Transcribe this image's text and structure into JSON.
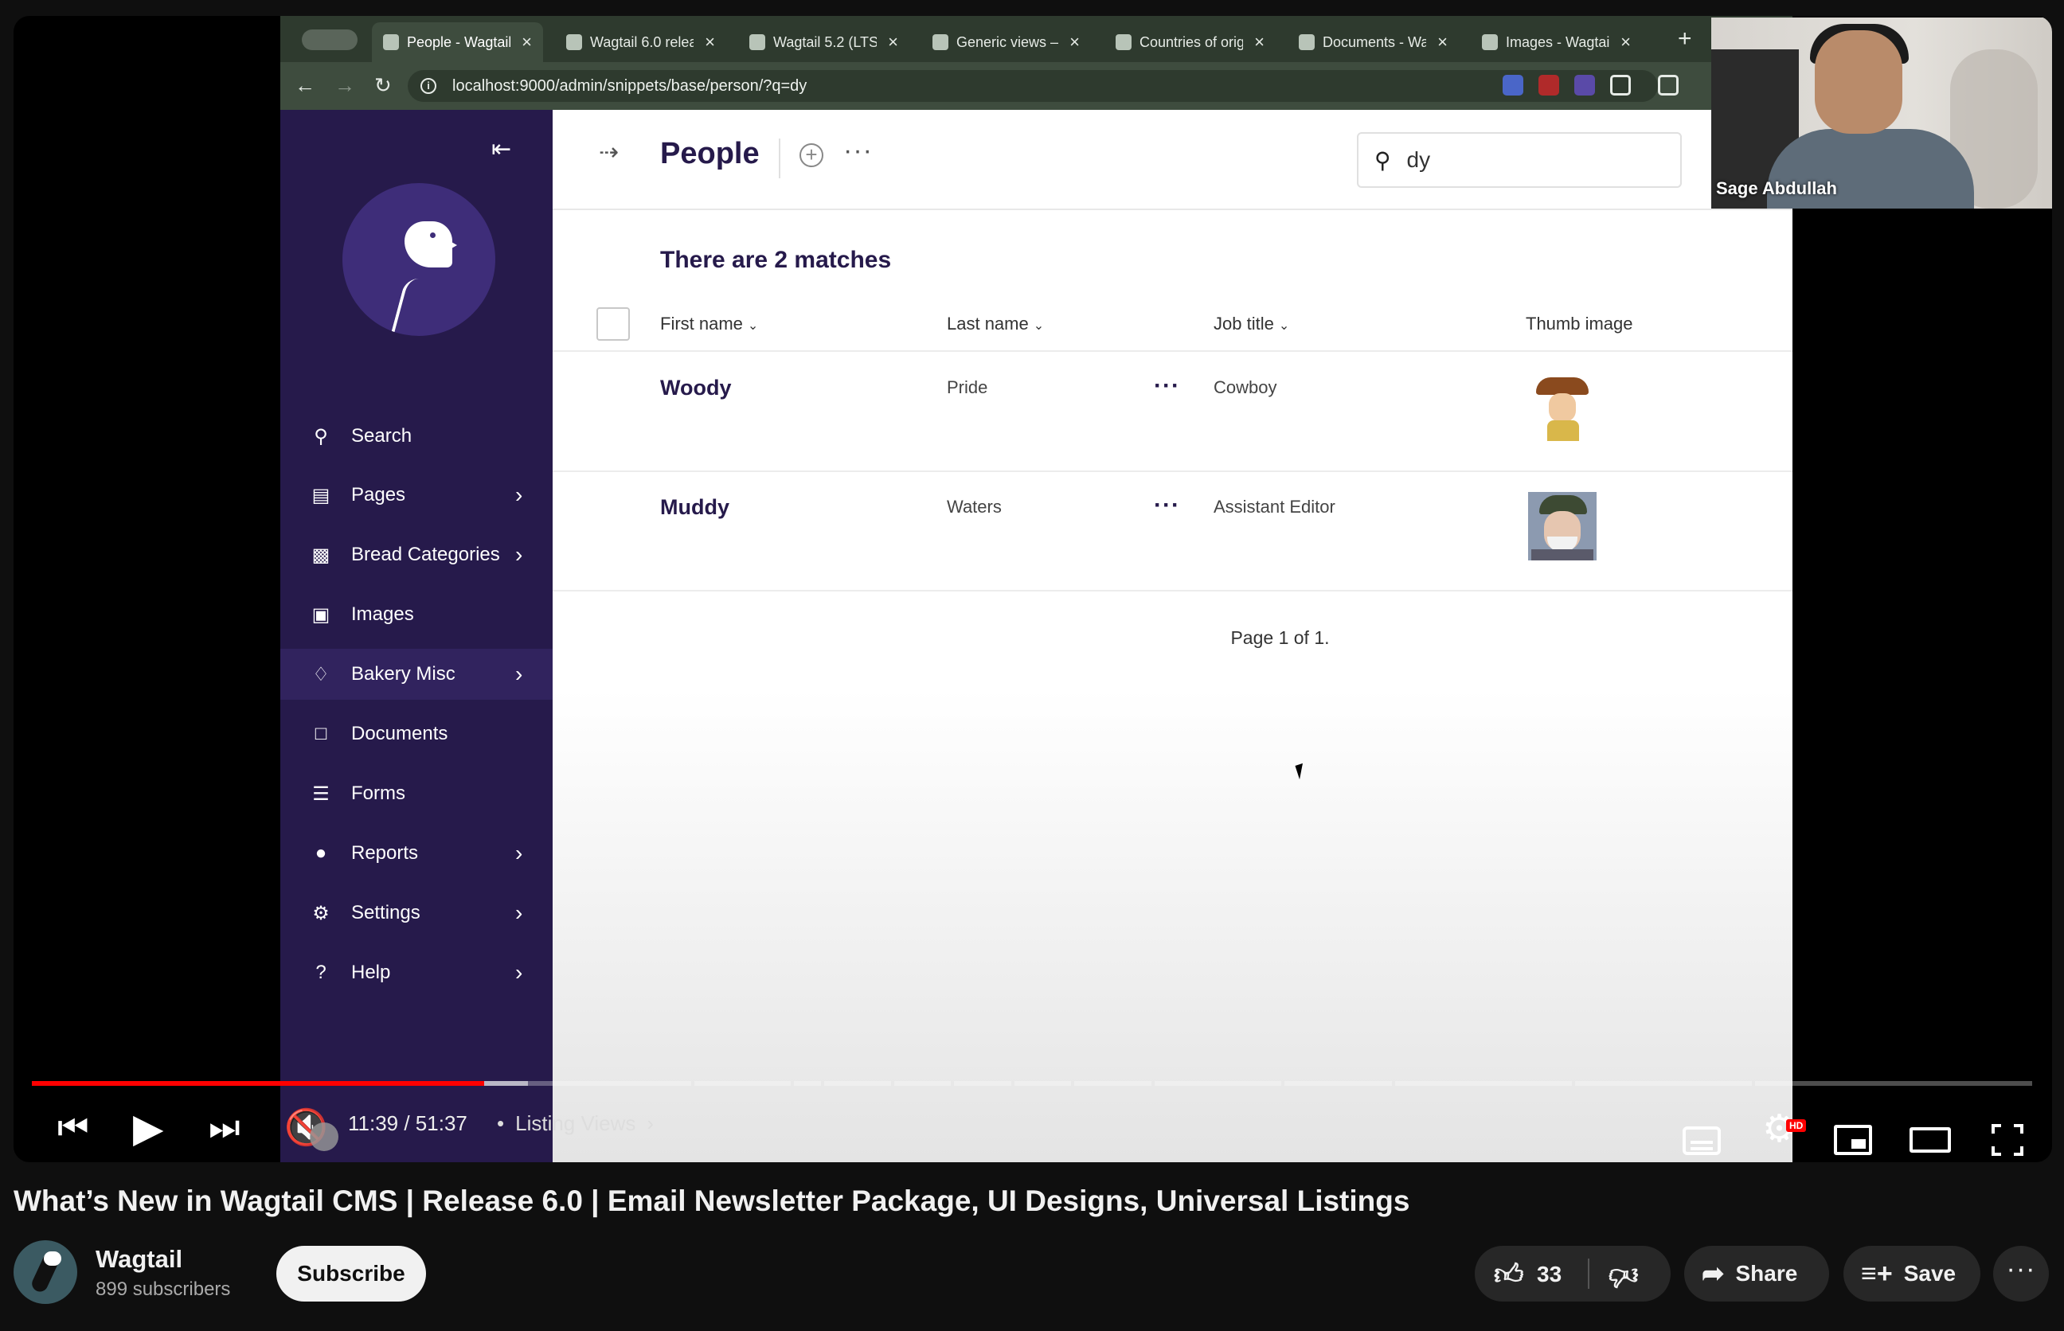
{
  "browser": {
    "tabs": [
      {
        "label": "People - Wagtail",
        "active": true
      },
      {
        "label": "Wagtail 6.0 relea",
        "active": false
      },
      {
        "label": "Wagtail 5.2 (LTS",
        "active": false
      },
      {
        "label": "Generic views –",
        "active": false
      },
      {
        "label": "Countries of orig",
        "active": false
      },
      {
        "label": "Documents - Wa",
        "active": false
      },
      {
        "label": "Images - Wagtail",
        "active": false
      }
    ],
    "url": "localhost:9000/admin/snippets/base/person/?q=dy"
  },
  "sidebar": {
    "items": [
      {
        "label": "Search",
        "icon": "search-icon"
      },
      {
        "label": "Pages",
        "icon": "folder-icon"
      },
      {
        "label": "Bread Categories",
        "icon": "briefcase-icon"
      },
      {
        "label": "Images",
        "icon": "image-icon"
      },
      {
        "label": "Bakery Misc",
        "icon": "utensils-icon"
      },
      {
        "label": "Documents",
        "icon": "document-icon"
      },
      {
        "label": "Forms",
        "icon": "list-icon"
      },
      {
        "label": "Reports",
        "icon": "globe-icon"
      },
      {
        "label": "Settings",
        "icon": "cogs-icon"
      },
      {
        "label": "Help",
        "icon": "help-icon"
      }
    ]
  },
  "content": {
    "title": "People",
    "search_value": "dy",
    "matches": "There are 2 matches",
    "columns": [
      "First name",
      "Last name",
      "Job title",
      "Thumb image"
    ],
    "rows": [
      {
        "first": "Woody",
        "last": "Pride",
        "job": "Cowboy",
        "thumb": "woody-thumbnail"
      },
      {
        "first": "Muddy",
        "last": "Waters",
        "job": "Assistant Editor",
        "thumb": "muddy-thumbnail"
      }
    ],
    "pager": "Page 1 of 1."
  },
  "webcam": {
    "name": "Sage Abdullah"
  },
  "player": {
    "time": "11:39 / 51:37",
    "chapter": "Listing Views",
    "progress_fraction": 0.226,
    "buffered_fraction": 0.248,
    "hd_badge": "HD"
  },
  "video": {
    "title": "What’s New in Wagtail CMS | Release 6.0 | Email Newsletter Package, UI Designs, Universal Listings",
    "channel": "Wagtail",
    "subscribers": "899 subscribers",
    "subscribe_label": "Subscribe",
    "likes": "33",
    "share_label": "Share",
    "save_label": "Save"
  },
  "colors": {
    "wagtail_sidebar": "#261a4b",
    "youtube_red": "#ff0000",
    "page_bg": "#0f0f0f"
  }
}
